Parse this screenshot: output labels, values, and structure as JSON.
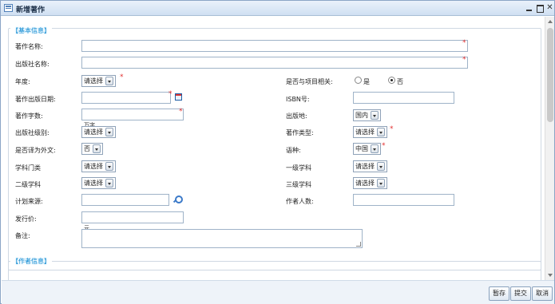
{
  "window": {
    "title": "新增著作",
    "controls": [
      "minimize-icon",
      "maximize-icon",
      "close-icon"
    ]
  },
  "sections": {
    "basic": "【基本信息】",
    "author": "【作者信息】"
  },
  "form": {
    "title_label": "著作名称:",
    "publisher_label": "出版社名称:",
    "year_label": "年度:",
    "year_value": "请选择",
    "project_related_label": "是否与项目相关:",
    "radio_yes": "是",
    "radio_no": "否",
    "project_related_selected": "否",
    "pub_date_label": "著作出版日期:",
    "isbn_label": "ISBN号:",
    "word_count_label": "著作字数:",
    "word_count_unit": "万字",
    "pub_place_label": "出版地:",
    "pub_place_value": "国内",
    "publisher_level_label": "出版社级别:",
    "publisher_level_value": "请选择",
    "work_type_label": "著作类型:",
    "work_type_value": "请选择",
    "translated_label": "是否译为外文:",
    "translated_value": "否",
    "language_label": "语种:",
    "language_value": "中国",
    "discipline_label": "学科门类",
    "discipline_value": "请选择",
    "first_subject_label": "一级学科",
    "first_subject_value": "请选择",
    "second_subject_label": "二级学科",
    "second_subject_value": "请选择",
    "third_subject_label": "三级学科",
    "third_subject_value": "请选择",
    "plan_source_label": "计划来源:",
    "author_count_label": "作者人数:",
    "price_label": "发行价:",
    "price_unit": "元",
    "remark_label": "备注:"
  },
  "buttons": {
    "save": "暂存",
    "submit": "提交",
    "cancel": "取消"
  }
}
